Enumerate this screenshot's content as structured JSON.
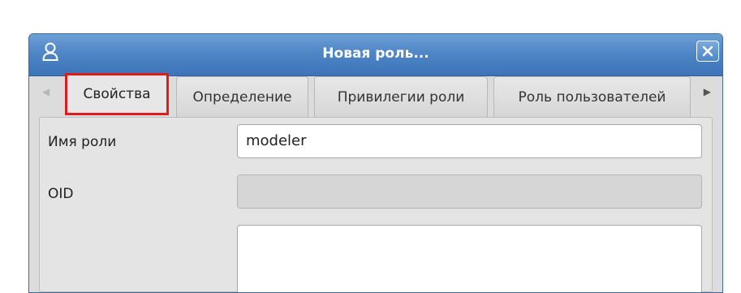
{
  "window": {
    "title": "Новая роль..."
  },
  "tabs": [
    {
      "label": "Свойства",
      "active": true
    },
    {
      "label": "Определение",
      "active": false
    },
    {
      "label": "Привилегии роли",
      "active": false
    },
    {
      "label": "Роль пользователей",
      "active": false
    }
  ],
  "form": {
    "role_name_label": "Имя роли",
    "role_name_value": "modeler",
    "oid_label": "OID",
    "oid_value": "",
    "comment_value": ""
  },
  "colors": {
    "titlebar": "#4f86c6",
    "highlight": "#e01b1b"
  }
}
